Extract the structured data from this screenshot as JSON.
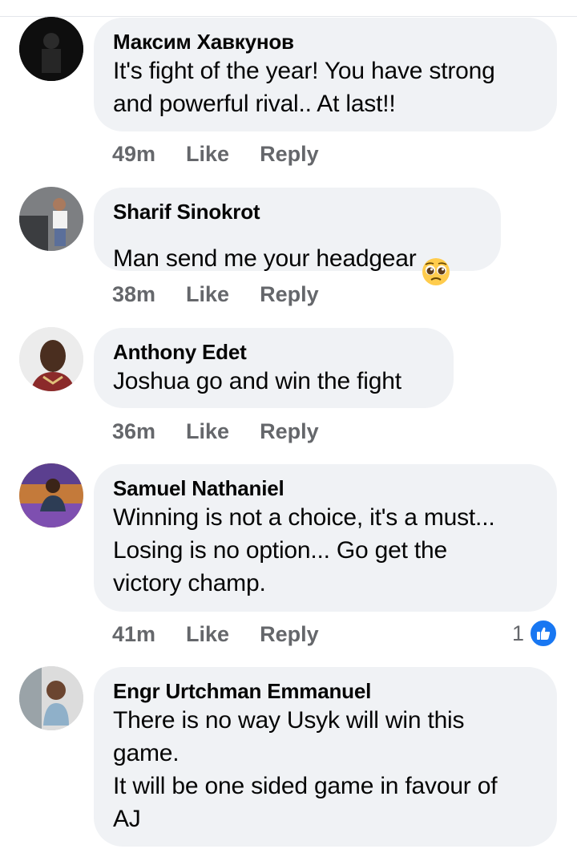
{
  "comments": [
    {
      "name": "Максим Хавкунов",
      "text": "It's fight of the year! You have strong\nand powerful rival.. At last!!",
      "time": "49m",
      "like": "Like",
      "reply": "Reply"
    },
    {
      "name": "Sharif Sinokrot",
      "text": "Man send me your headgear",
      "emoji": "pleading-face-emoji",
      "time": "38m",
      "like": "Like",
      "reply": "Reply"
    },
    {
      "name": "Anthony Edet",
      "text": "Joshua go and win the fight",
      "time": "36m",
      "like": "Like",
      "reply": "Reply"
    },
    {
      "name": "Samuel Nathaniel",
      "text": "Winning is not a choice, it's a must...\nLosing is no option... Go get the\nvictory champ.",
      "time": "41m",
      "like": "Like",
      "reply": "Reply",
      "reaction_count": "1",
      "reaction_icon": "thumbs-up-icon"
    },
    {
      "name": "Engr Urtchman Emmanuel",
      "text": "There is no way Usyk will win this\ngame.\nIt will be one sided game in favour of\nAJ"
    }
  ],
  "colors": {
    "bubble": "#f0f2f5",
    "meta_text": "#65676b",
    "like_blue": "#1877f2"
  }
}
